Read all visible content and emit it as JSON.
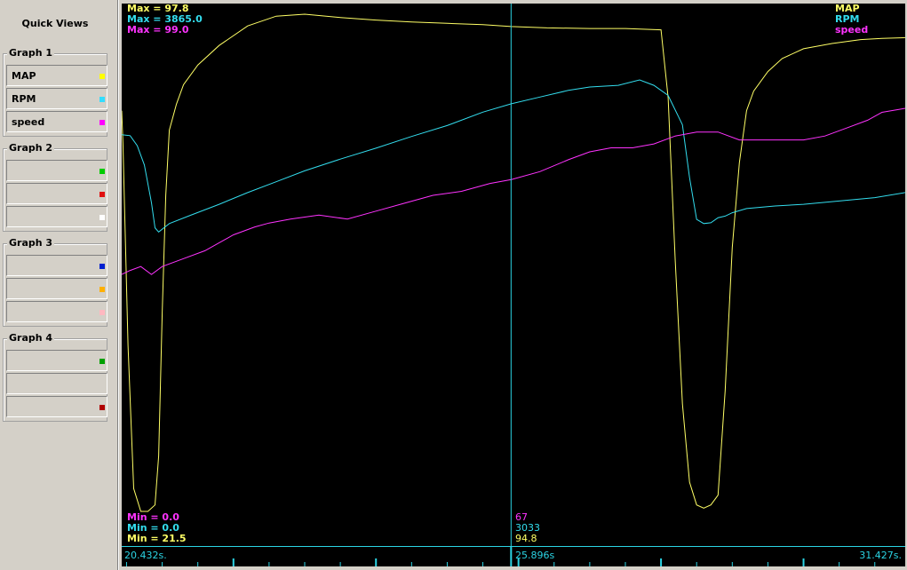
{
  "sidebar": {
    "title": "Quick Views",
    "groups": [
      {
        "title": "Graph 1",
        "items": [
          {
            "label": "MAP",
            "color": "#ffff00"
          },
          {
            "label": "RPM",
            "color": "#33ddff"
          },
          {
            "label": "speed",
            "color": "#ff00ff"
          }
        ]
      },
      {
        "title": "Graph 2",
        "items": [
          {
            "label": "",
            "color": "#00cc00"
          },
          {
            "label": "",
            "color": "#e01010"
          },
          {
            "label": "",
            "color": "#ffffff"
          }
        ]
      },
      {
        "title": "Graph 3",
        "items": [
          {
            "label": "",
            "color": "#0020d0"
          },
          {
            "label": "",
            "color": "#ffb000"
          },
          {
            "label": "",
            "color": "#ffb8c0"
          }
        ]
      },
      {
        "title": "Graph 4",
        "items": [
          {
            "label": "",
            "color": "#00a000"
          },
          {
            "label": "",
            "color": "#d4d0c8"
          },
          {
            "label": "",
            "color": "#b00000"
          }
        ]
      }
    ]
  },
  "plot": {
    "max_labels": {
      "map": "Max = 97.8",
      "rpm": "Max = 3865.0",
      "speed": "Max = 99.0"
    },
    "min_labels": {
      "speed": "Min = 0.0",
      "rpm": "Min = 0.0",
      "map": "Min = 21.5"
    },
    "legend": {
      "map": "MAP",
      "rpm": "RPM",
      "speed": "speed"
    },
    "cursor_values": {
      "speed": "67",
      "rpm": "3033",
      "map": "94.8"
    },
    "colors": {
      "map": "#ffff66",
      "rpm": "#33ddee",
      "speed": "#ff33ff",
      "cursor": "#2bd4e4"
    }
  },
  "timeline": {
    "start": "20.432s.",
    "cursor": "25.896s",
    "end": "31.427s."
  },
  "chart_data": {
    "type": "line",
    "x_range": [
      20.432,
      31.427
    ],
    "cursor_x": 25.896,
    "series": [
      {
        "name": "MAP",
        "min": 21.5,
        "max": 97.8,
        "x": [
          20.432,
          20.45,
          20.52,
          20.6,
          20.7,
          20.8,
          20.9,
          20.95,
          21.0,
          21.05,
          21.1,
          21.15,
          21.2,
          21.3,
          21.5,
          21.8,
          22.2,
          22.6,
          23.0,
          23.5,
          24.0,
          24.5,
          25.0,
          25.5,
          25.9,
          26.4,
          27.0,
          27.5,
          28.0,
          28.1,
          28.2,
          28.3,
          28.4,
          28.5,
          28.6,
          28.7,
          28.8,
          28.9,
          29.0,
          29.1,
          29.2,
          29.3,
          29.5,
          29.7,
          30.0,
          30.4,
          30.8,
          31.1,
          31.427
        ],
        "values": [
          83,
          78,
          47,
          25,
          21.5,
          21.5,
          22.5,
          30,
          52,
          70,
          80,
          82,
          84,
          87,
          90,
          93,
          96,
          97.5,
          97.8,
          97.3,
          96.9,
          96.6,
          96.4,
          96.2,
          95.9,
          95.7,
          95.6,
          95.6,
          95.4,
          85,
          60,
          38,
          26,
          22.5,
          22,
          22.5,
          24,
          40,
          62,
          75,
          83,
          86,
          89,
          91,
          92.5,
          93.3,
          93.9,
          94.1,
          94.2
        ]
      },
      {
        "name": "RPM",
        "min": 0.0,
        "max": 3865.0,
        "x": [
          20.432,
          20.55,
          20.65,
          20.75,
          20.85,
          20.9,
          20.95,
          21.1,
          21.4,
          21.8,
          22.2,
          22.6,
          23.0,
          23.5,
          24.0,
          24.5,
          25.0,
          25.5,
          25.9,
          26.3,
          26.7,
          27.0,
          27.4,
          27.7,
          27.9,
          28.1,
          28.3,
          28.4,
          28.5,
          28.6,
          28.7,
          28.8,
          28.9,
          29.0,
          29.2,
          29.6,
          30.0,
          30.5,
          31.0,
          31.427
        ],
        "values": [
          3210,
          3200,
          3080,
          2850,
          2400,
          2100,
          2050,
          2150,
          2250,
          2380,
          2520,
          2650,
          2780,
          2920,
          3050,
          3190,
          3320,
          3480,
          3580,
          3660,
          3740,
          3780,
          3800,
          3865,
          3800,
          3680,
          3330,
          2700,
          2200,
          2150,
          2160,
          2220,
          2240,
          2280,
          2330,
          2360,
          2380,
          2420,
          2460,
          2520
        ]
      },
      {
        "name": "speed",
        "min": 0.0,
        "max": 99.0,
        "x": [
          20.432,
          20.55,
          20.7,
          20.85,
          21.0,
          21.3,
          21.6,
          22.0,
          22.3,
          22.5,
          22.8,
          23.2,
          23.6,
          24.0,
          24.4,
          24.8,
          25.2,
          25.6,
          25.9,
          26.3,
          26.7,
          27.0,
          27.3,
          27.6,
          27.9,
          28.2,
          28.5,
          28.8,
          29.1,
          29.3,
          29.6,
          30.0,
          30.3,
          30.6,
          30.9,
          31.1,
          31.427
        ],
        "values": [
          52,
          53,
          54,
          52,
          54,
          56,
          58,
          62,
          64,
          65,
          66,
          67,
          66,
          68,
          70,
          72,
          73,
          75,
          76,
          78,
          81,
          83,
          84,
          84,
          85,
          87,
          88,
          88,
          86,
          86,
          86,
          86,
          87,
          89,
          91,
          93,
          94
        ]
      }
    ]
  }
}
